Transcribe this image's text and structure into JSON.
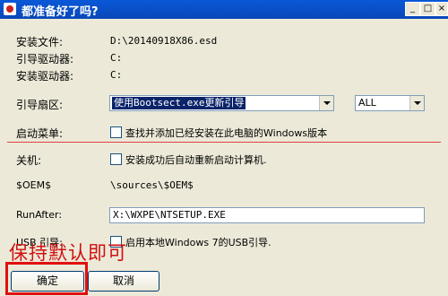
{
  "window": {
    "title": "都准备好了吗?"
  },
  "titlebar": {
    "minimize": "_",
    "maximize": "□",
    "close": "×"
  },
  "fields": {
    "install_file_label": "安装文件:",
    "install_file_value": "D:\\20140918X86.esd",
    "boot_drive_label": "引导驱动器:",
    "boot_drive_value": "C:",
    "install_drive_label": "安装驱动器:",
    "install_drive_value": "C:",
    "boot_sector_label": "引导扇区:",
    "boot_sector_value": "使用Bootsect.exe更新引导",
    "boot_sector_scope": "ALL",
    "boot_menu_label": "启动菜单:",
    "boot_menu_option": "查找并添加已经安装在此电脑的Windows版本",
    "shutdown_label": "关机:",
    "shutdown_option": "安装成功后自动重新启动计算机.",
    "oem_label": "$OEM$",
    "oem_value": "\\sources\\$OEM$",
    "runafter_label": "RunAfter:",
    "runafter_value": "X:\\WXPE\\NTSETUP.EXE",
    "usb_label": "USB 引导:",
    "usb_option": "启用本地Windows 7的USB引导."
  },
  "annotation": {
    "text": "保持默认即可"
  },
  "buttons": {
    "ok": "确定",
    "cancel": "取消"
  }
}
